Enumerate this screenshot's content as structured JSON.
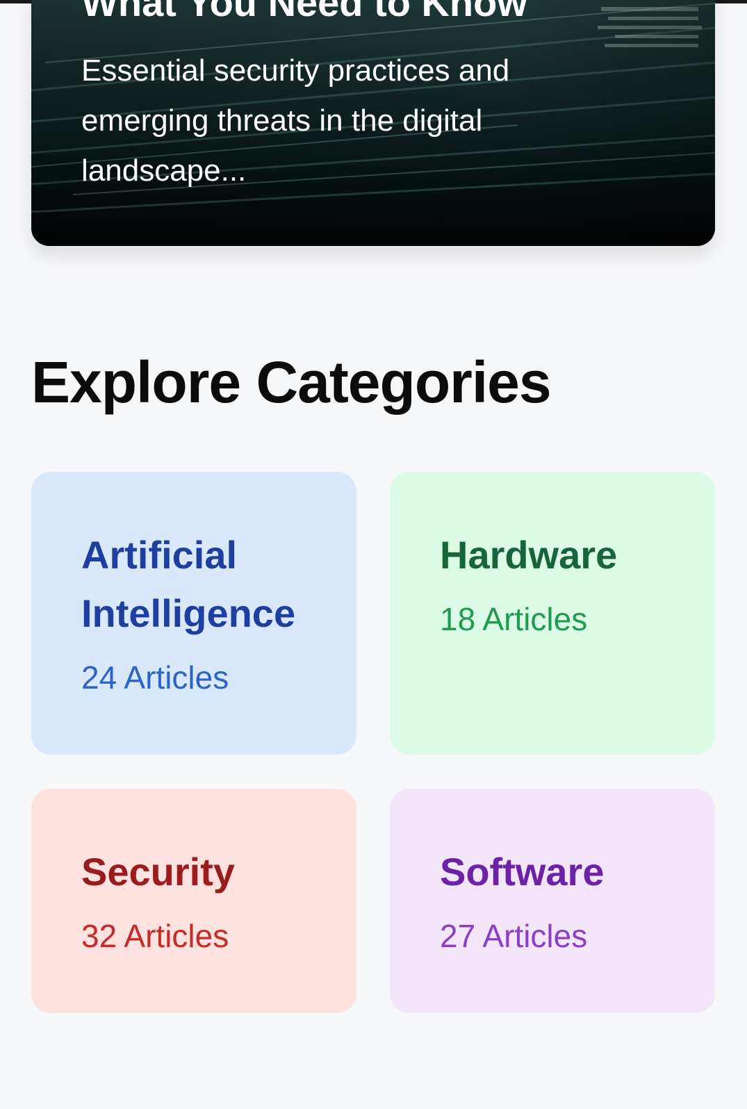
{
  "featured": {
    "title": "What You Need to Know",
    "excerpt": "Essential security practices and emerging threats in the digital landscape..."
  },
  "categories_section": {
    "title": "Explore Categories",
    "items": [
      {
        "name": "Artificial Intelligence",
        "count": "24 Articles",
        "color": "#1e3f9f",
        "bg": "#dae8fc"
      },
      {
        "name": "Hardware",
        "count": "18 Articles",
        "color": "#17663a",
        "bg": "#dcfbe6"
      },
      {
        "name": "Security",
        "count": "32 Articles",
        "color": "#9b1c1c",
        "bg": "#fde2df"
      },
      {
        "name": "Software",
        "count": "27 Articles",
        "color": "#6b22a6",
        "bg": "#f3e6fb"
      }
    ]
  }
}
